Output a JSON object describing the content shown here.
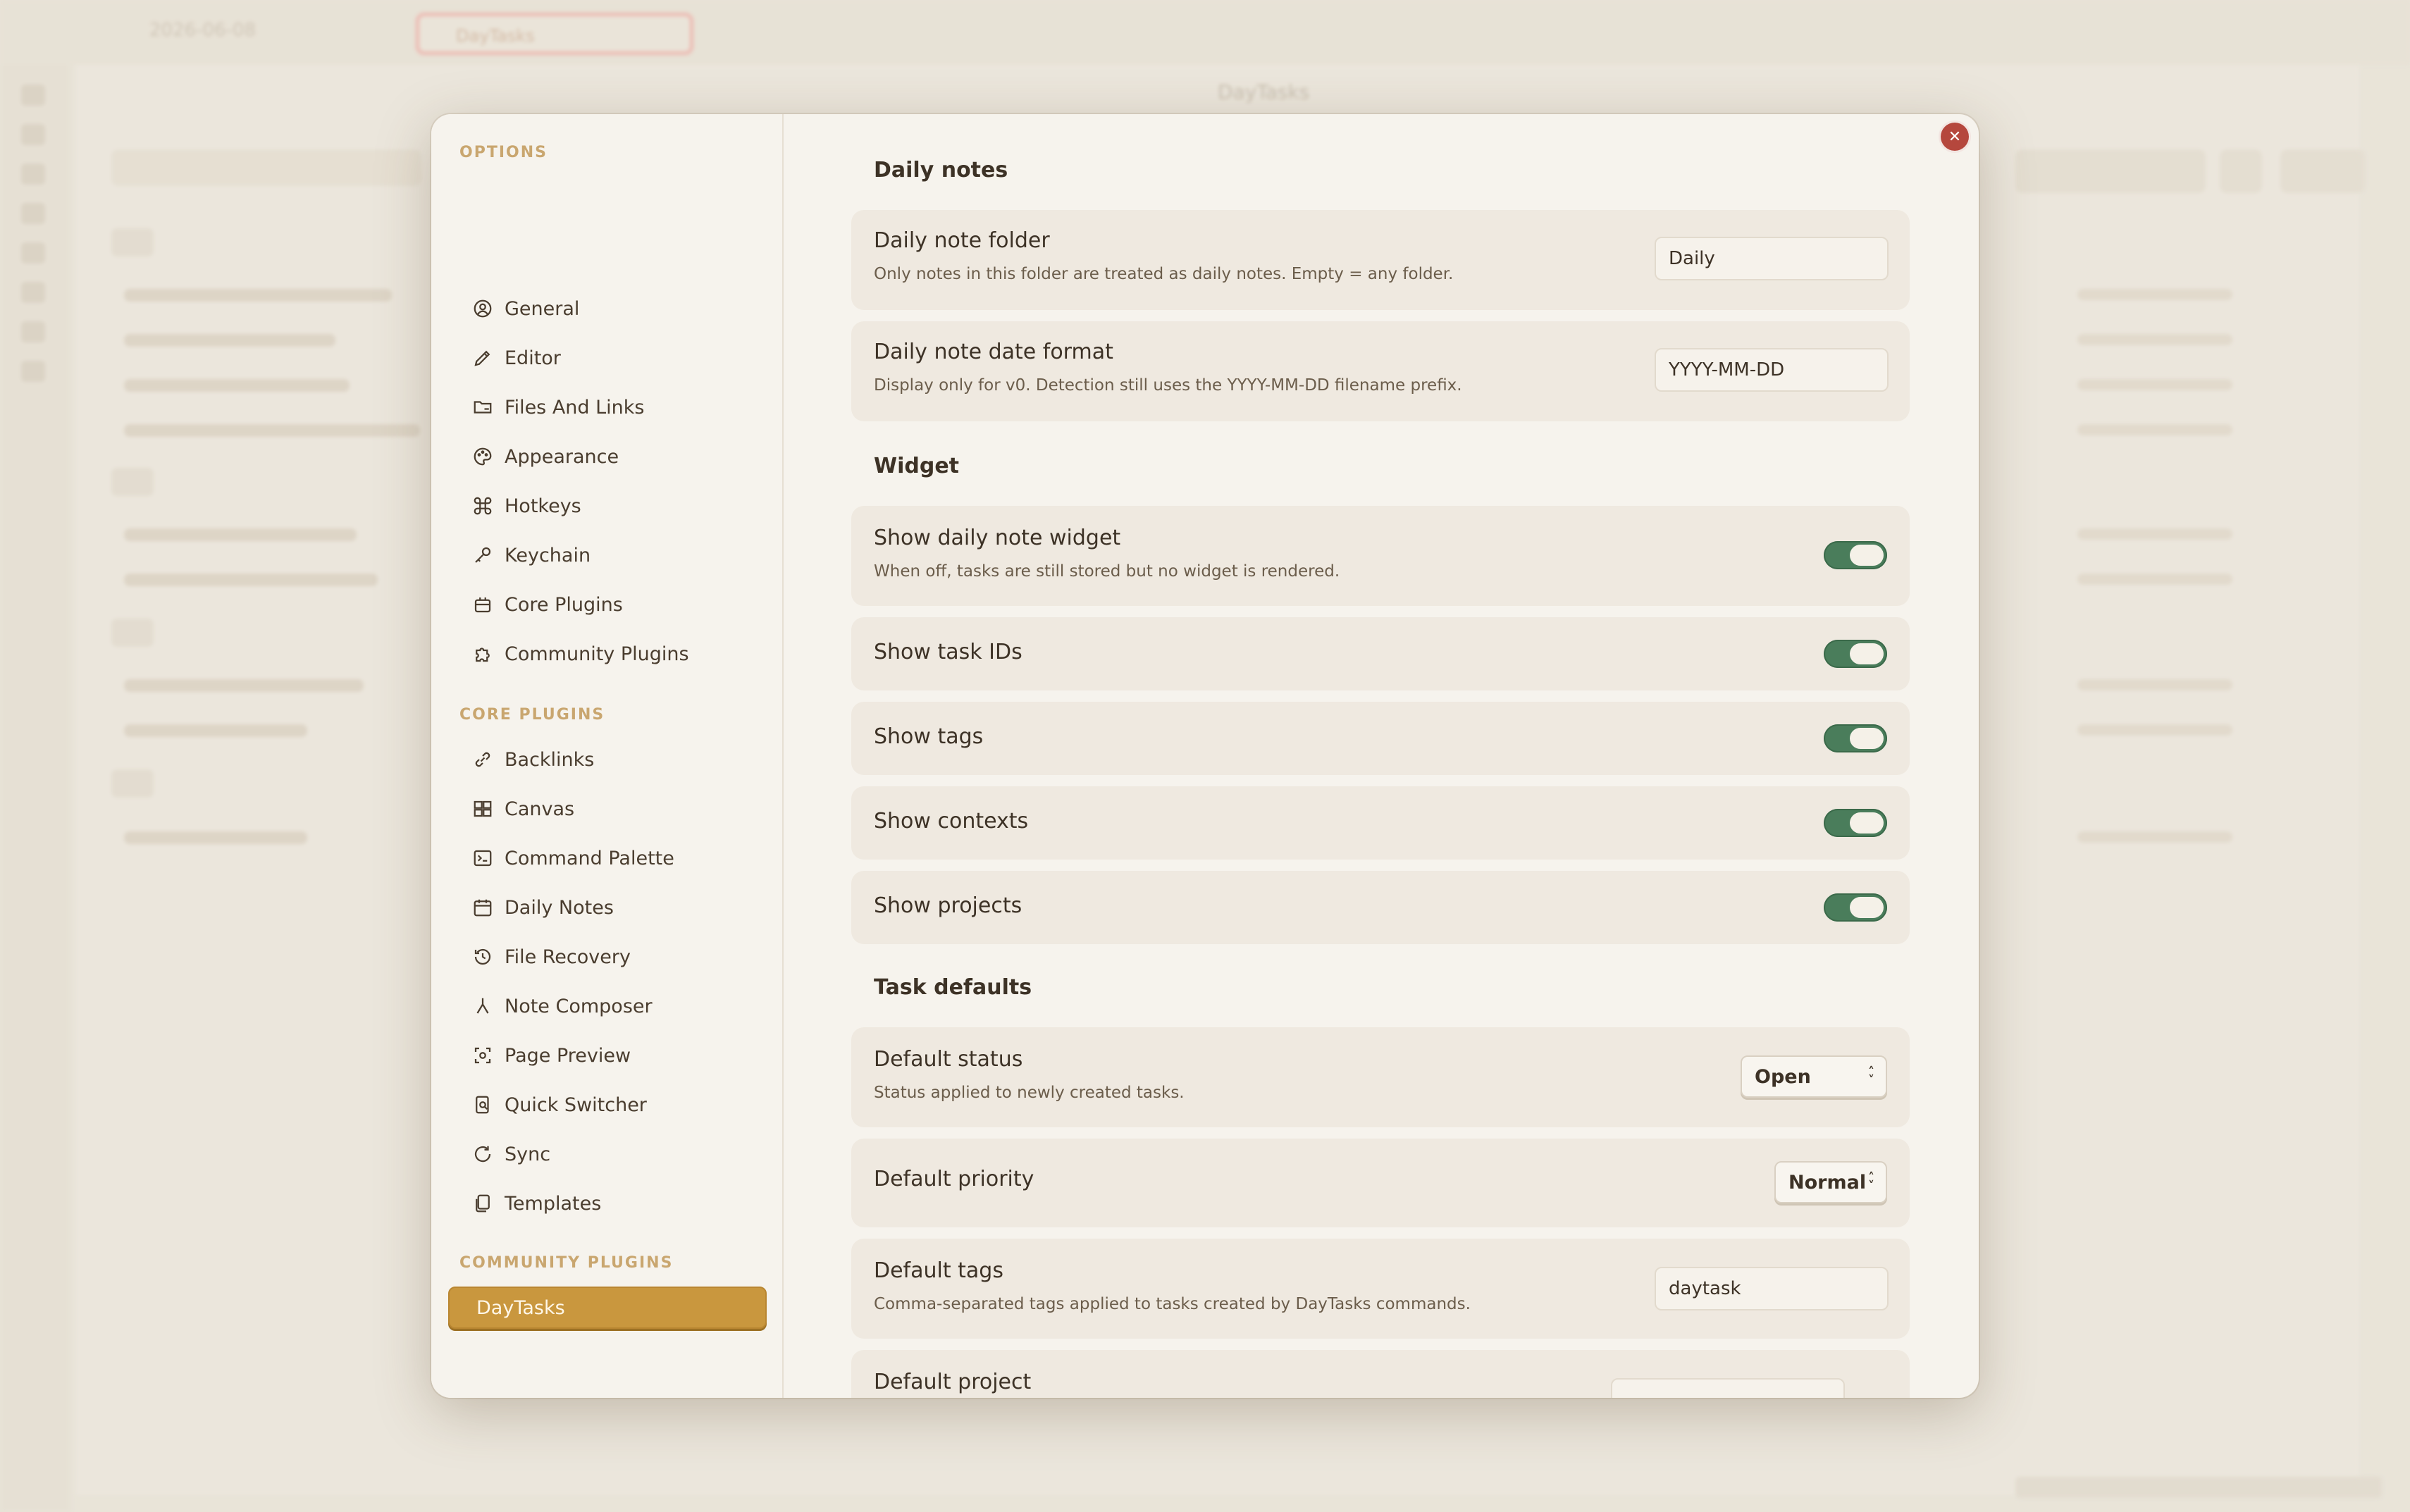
{
  "background": {
    "tab_label": "DayTasks",
    "date_label": "2026-06-08",
    "title": "DayTasks"
  },
  "sidebar": {
    "options_heading": "OPTIONS",
    "options": [
      {
        "label": "General",
        "icon": "user-circle-icon"
      },
      {
        "label": "Editor",
        "icon": "pencil-icon"
      },
      {
        "label": "Files And Links",
        "icon": "folder-link-icon"
      },
      {
        "label": "Appearance",
        "icon": "palette-icon"
      },
      {
        "label": "Hotkeys",
        "icon": "command-icon"
      },
      {
        "label": "Keychain",
        "icon": "key-icon"
      },
      {
        "label": "Core Plugins",
        "icon": "plug-box-icon"
      },
      {
        "label": "Community Plugins",
        "icon": "puzzle-icon"
      }
    ],
    "core_heading": "CORE PLUGINS",
    "core": [
      {
        "label": "Backlinks",
        "icon": "backlinks-icon"
      },
      {
        "label": "Canvas",
        "icon": "canvas-icon"
      },
      {
        "label": "Command Palette",
        "icon": "terminal-icon"
      },
      {
        "label": "Daily Notes",
        "icon": "calendar-icon"
      },
      {
        "label": "File Recovery",
        "icon": "history-icon"
      },
      {
        "label": "Note Composer",
        "icon": "merge-icon"
      },
      {
        "label": "Page Preview",
        "icon": "preview-icon"
      },
      {
        "label": "Quick Switcher",
        "icon": "switcher-icon"
      },
      {
        "label": "Sync",
        "icon": "sync-icon"
      },
      {
        "label": "Templates",
        "icon": "templates-icon"
      }
    ],
    "community_heading": "COMMUNITY PLUGINS",
    "community": [
      {
        "label": "DayTasks",
        "active": true
      }
    ]
  },
  "settings": {
    "daily_notes": {
      "heading": "Daily notes",
      "folder": {
        "title": "Daily note folder",
        "desc": "Only notes in this folder are treated as daily notes. Empty = any folder.",
        "value": "Daily"
      },
      "date_format": {
        "title": "Daily note date format",
        "desc": "Display only for v0. Detection still uses the YYYY-MM-DD filename prefix.",
        "value": "YYYY-MM-DD"
      }
    },
    "widget": {
      "heading": "Widget",
      "show_widget": {
        "title": "Show daily note widget",
        "desc": "When off, tasks are still stored but no widget is rendered.",
        "on": true
      },
      "show_ids": {
        "title": "Show task IDs",
        "on": true
      },
      "show_tags": {
        "title": "Show tags",
        "on": true
      },
      "show_contexts": {
        "title": "Show contexts",
        "on": true
      },
      "show_projects": {
        "title": "Show projects",
        "on": true
      }
    },
    "task_defaults": {
      "heading": "Task defaults",
      "status": {
        "title": "Default status",
        "desc": "Status applied to newly created tasks.",
        "value": "Open"
      },
      "priority": {
        "title": "Default priority",
        "value": "Normal"
      },
      "tags": {
        "title": "Default tags",
        "desc": "Comma-separated tags applied to tasks created by DayTasks commands.",
        "value": "daytask"
      },
      "project": {
        "title": "Default project"
      }
    }
  },
  "colors": {
    "accent": "#c9973e",
    "toggle_on": "#4a7d5b",
    "close": "#b5473d"
  }
}
